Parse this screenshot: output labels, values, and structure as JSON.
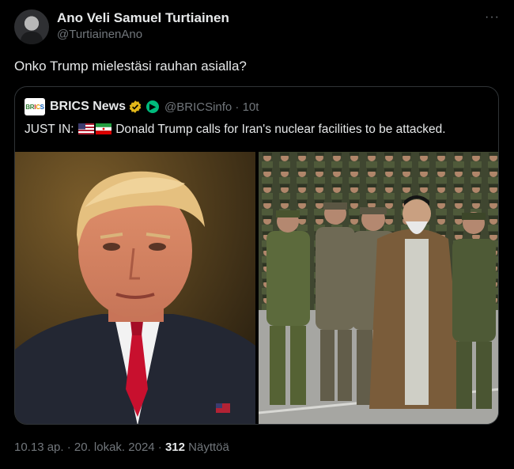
{
  "author": {
    "name": "Ano Veli Samuel Turtiainen",
    "handle": "@TurtiainenAno"
  },
  "more_icon": "more-icon",
  "tweet": {
    "text": "Onko Trump mielestäsi rauhan asialla?"
  },
  "quote": {
    "logo_text": [
      "BR",
      "I",
      "C",
      "S"
    ],
    "name": "BRICS News",
    "handle_time": "@BRICSinfo · 10t",
    "text_prefix": "JUST IN:",
    "text_main": "Donald Trump calls for Iran's nuclear facilities to be attacked.",
    "flags": [
      "us-flag",
      "iran-flag"
    ]
  },
  "footer": {
    "time_date": "10.13 ap. · 20. lokak. 2024 · ",
    "views_count": "312",
    "views_label": " Näyttöä"
  },
  "colors": {
    "background": "#000000",
    "primary_text": "#e7e9ea",
    "secondary_text": "#71767b",
    "border": "#2f3336",
    "verified_gold": "#e2b719",
    "bot_green": "#00ba7c"
  }
}
